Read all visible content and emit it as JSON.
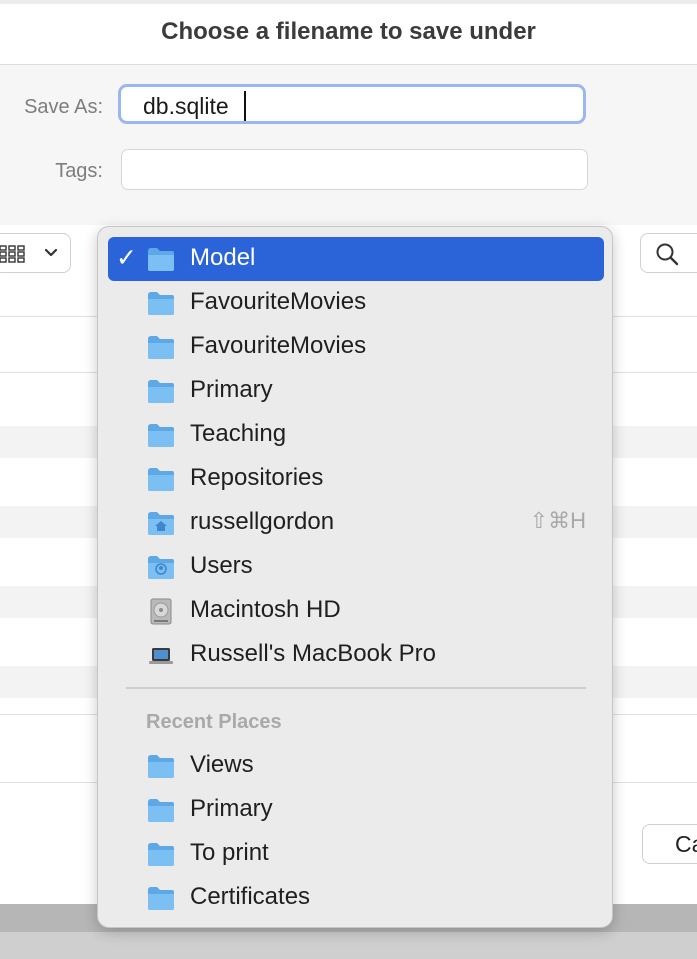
{
  "dialog": {
    "title": "Choose a filename to save under",
    "save_as_label": "Save As:",
    "save_as_value": "db.sqlite",
    "tags_label": "Tags:",
    "tags_value": "",
    "cancel_label": "Ca"
  },
  "menu": {
    "items": [
      {
        "label": "Model",
        "icon": "folder-icon",
        "selected": true
      },
      {
        "label": "FavouriteMovies",
        "icon": "folder-icon"
      },
      {
        "label": "FavouriteMovies",
        "icon": "folder-icon"
      },
      {
        "label": "Primary",
        "icon": "folder-icon"
      },
      {
        "label": "Teaching",
        "icon": "folder-icon"
      },
      {
        "label": "Repositories",
        "icon": "folder-icon"
      },
      {
        "label": "russellgordon",
        "icon": "home-folder-icon",
        "shortcut": "⇧⌘H"
      },
      {
        "label": "Users",
        "icon": "users-folder-icon"
      },
      {
        "label": "Macintosh HD",
        "icon": "hard-drive-icon"
      },
      {
        "label": "Russell's MacBook Pro",
        "icon": "laptop-icon"
      }
    ],
    "recent_header": "Recent Places",
    "recent": [
      {
        "label": "Views",
        "icon": "folder-icon"
      },
      {
        "label": "Primary",
        "icon": "folder-icon"
      },
      {
        "label": "To print",
        "icon": "folder-icon"
      },
      {
        "label": "Certificates",
        "icon": "folder-icon"
      }
    ]
  },
  "colors": {
    "accent": "#2b63d9",
    "focus_ring": "#9bb6f0",
    "folder": "#6bb3ee"
  }
}
